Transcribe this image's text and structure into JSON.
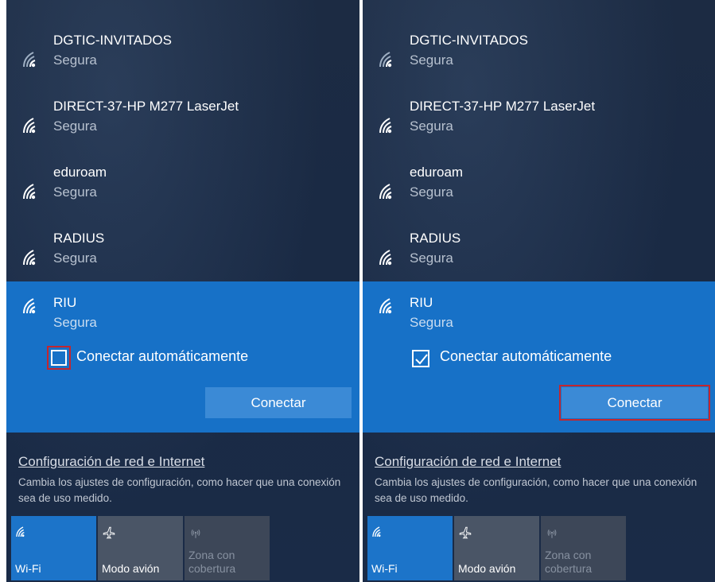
{
  "panels": [
    {
      "networks": [
        {
          "ssid": "DGTIC-INVITADOS",
          "status": "Segura"
        },
        {
          "ssid": "DIRECT-37-HP M277 LaserJet",
          "status": "Segura"
        },
        {
          "ssid": "eduroam",
          "status": "Segura"
        },
        {
          "ssid": "RADIUS",
          "status": "Segura"
        }
      ],
      "selected": {
        "ssid": "RIU",
        "status": "Segura",
        "auto_connect_label": "Conectar automáticamente",
        "auto_connect_checked": false,
        "connect_label": "Conectar"
      },
      "settings": {
        "link": "Configuración de red e Internet",
        "description": "Cambia los ajustes de configuración, como hacer que una conexión sea de uso medido."
      },
      "quick_actions": [
        {
          "label": "Wi-Fi",
          "icon": "wifi-icon",
          "active": true
        },
        {
          "label": "Modo avión",
          "icon": "airplane-icon",
          "active": false
        },
        {
          "label": "Zona con cobertura",
          "icon": "hotspot-icon",
          "active": false,
          "disabled": true
        }
      ]
    },
    {
      "networks": [
        {
          "ssid": "DGTIC-INVITADOS",
          "status": "Segura"
        },
        {
          "ssid": "DIRECT-37-HP M277 LaserJet",
          "status": "Segura"
        },
        {
          "ssid": "eduroam",
          "status": "Segura"
        },
        {
          "ssid": "RADIUS",
          "status": "Segura"
        }
      ],
      "selected": {
        "ssid": "RIU",
        "status": "Segura",
        "auto_connect_label": "Conectar automáticamente",
        "auto_connect_checked": true,
        "connect_label": "Conectar"
      },
      "settings": {
        "link": "Configuración de red e Internet",
        "description": "Cambia los ajustes de configuración, como hacer que una conexión sea de uso medido."
      },
      "quick_actions": [
        {
          "label": "Wi-Fi",
          "icon": "wifi-icon",
          "active": true
        },
        {
          "label": "Modo avión",
          "icon": "airplane-icon",
          "active": false
        },
        {
          "label": "Zona con cobertura",
          "icon": "hotspot-icon",
          "active": false,
          "disabled": true
        }
      ]
    }
  ],
  "colors": {
    "panel_bg": "#1a2a44",
    "accent": "#1771c7",
    "button": "#3b8ad6",
    "highlight_border": "#c4262e"
  }
}
